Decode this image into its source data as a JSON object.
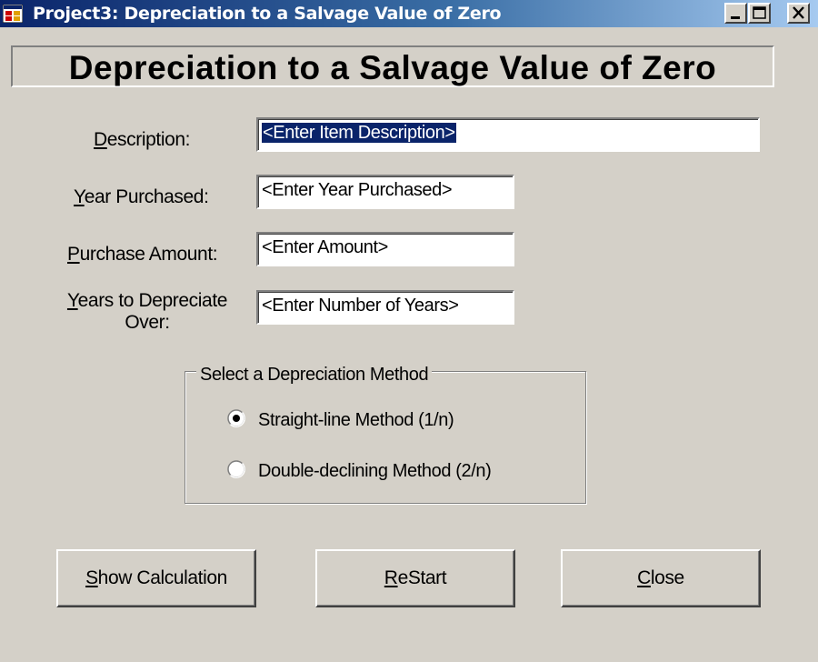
{
  "window": {
    "title": "Project3: Depreciation to a Salvage Value of Zero",
    "controls": [
      "minimize-icon",
      "maximize-icon",
      "close-icon"
    ]
  },
  "heading": "Depreciation to a Salvage Value of Zero",
  "form": {
    "description": {
      "mnemonic": "D",
      "rest": "escription:",
      "value": "<Enter Item Description>"
    },
    "year_purchased": {
      "mnemonic": "Y",
      "rest": "ear Purchased:",
      "value": "<Enter Year Purchased>"
    },
    "purchase_amount": {
      "mnemonic": "P",
      "rest": "urchase Amount:",
      "value": "<Enter Amount>"
    },
    "years_to_depreciate": {
      "mnemonic": "Y",
      "rest_line1": "ears to Depreciate",
      "line2": "Over:",
      "value": "<Enter Number of Years>"
    }
  },
  "method_group": {
    "legend": "Select a Depreciation Method",
    "options": [
      {
        "label": "Straight-line Method (1/n)",
        "selected": true
      },
      {
        "label": "Double-declining Method (2/n)",
        "selected": false
      }
    ]
  },
  "buttons": {
    "show_calculation": {
      "mnemonic": "S",
      "rest": "how Calculation"
    },
    "restart": {
      "mnemonic": "R",
      "rest": "eStart"
    },
    "close": {
      "mnemonic": "C",
      "rest": "lose"
    }
  }
}
